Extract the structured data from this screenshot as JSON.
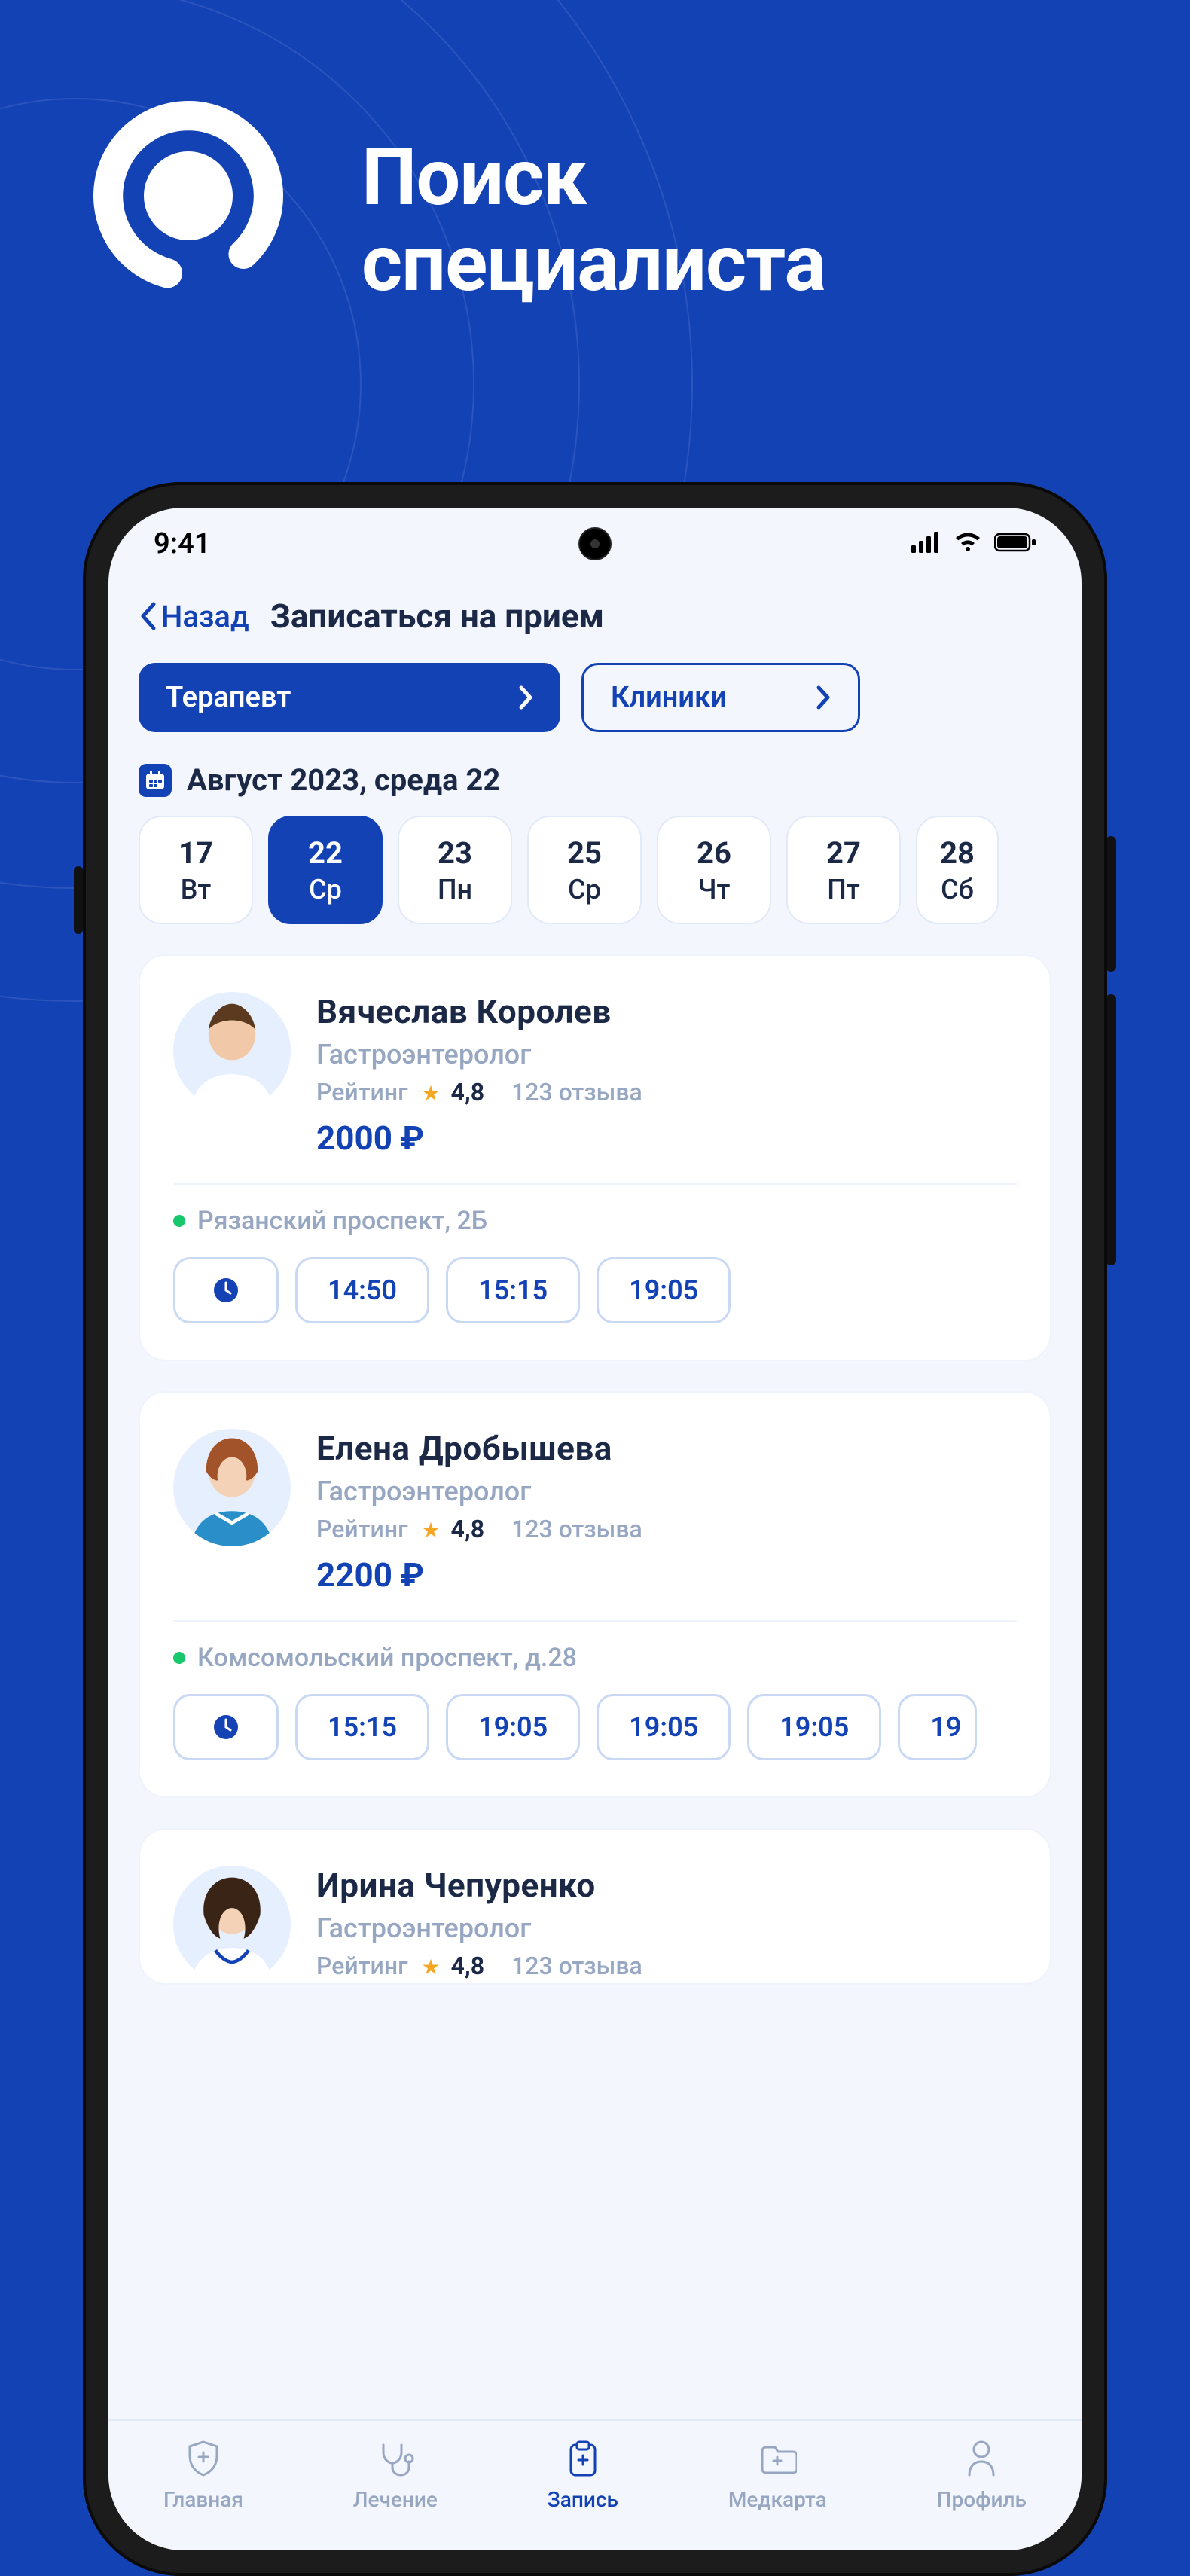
{
  "marketing": {
    "line1": "Поиск",
    "line2": "специалиста"
  },
  "statusbar": {
    "time": "9:41"
  },
  "nav": {
    "back": "Назад",
    "title": "Записаться на прием"
  },
  "filters": {
    "specialty": "Терапевт",
    "clinics": "Клиники"
  },
  "date": {
    "label": "Август 2023, среда 22"
  },
  "dateChips": [
    {
      "num": "17",
      "dow": "Вт"
    },
    {
      "num": "22",
      "dow": "Ср"
    },
    {
      "num": "23",
      "dow": "Пн"
    },
    {
      "num": "25",
      "dow": "Ср"
    },
    {
      "num": "26",
      "dow": "Чт"
    },
    {
      "num": "27",
      "dow": "Пт"
    },
    {
      "num": "28",
      "dow": "Сб"
    }
  ],
  "doctors": [
    {
      "name": "Вячеслав  Королев",
      "specialty": "Гастроэнтеролог",
      "ratingLabel": "Рейтинг",
      "rating": "4,8",
      "reviews": "123 отзыва",
      "price": "2000 ₽",
      "address": "Рязанский проспект, 2Б",
      "slots": [
        "14:50",
        "15:15",
        "19:05"
      ]
    },
    {
      "name": "Елена Дробышева",
      "specialty": "Гастроэнтеролог",
      "ratingLabel": "Рейтинг",
      "rating": "4,8",
      "reviews": "123 отзыва",
      "price": "2200 ₽",
      "address": "Комсомольский проспект, д.28",
      "slots": [
        "15:15",
        "19:05",
        "19:05",
        "19:05",
        "19"
      ]
    },
    {
      "name": "Ирина Чепуренко",
      "specialty": "Гастроэнтеролог",
      "ratingLabel": "Рейтинг",
      "rating": "4,8",
      "reviews": "123 отзыва"
    }
  ],
  "tabs": {
    "home": "Главная",
    "treat": "Лечение",
    "book": "Запись",
    "med": "Медкарта",
    "profile": "Профиль"
  }
}
